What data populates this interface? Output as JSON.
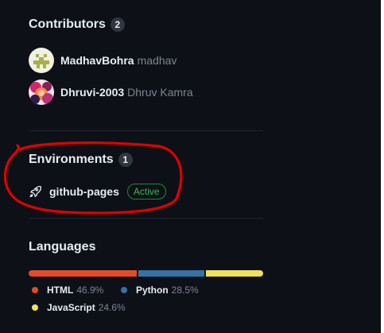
{
  "contributors": {
    "title": "Contributors",
    "count": "2",
    "items": [
      {
        "login": "MadhavBohra",
        "name": "madhav"
      },
      {
        "login": "Dhruvi-2003",
        "name": "Dhruv Kamra"
      }
    ]
  },
  "environments": {
    "title": "Environments",
    "count": "1",
    "items": [
      {
        "name": "github-pages",
        "status": "Active",
        "icon": "rocket-icon"
      }
    ]
  },
  "languages": {
    "title": "Languages",
    "items": [
      {
        "name": "HTML",
        "percent": "46.9%",
        "color": "#e34c26"
      },
      {
        "name": "Python",
        "percent": "28.5%",
        "color": "#3572a5"
      },
      {
        "name": "JavaScript",
        "percent": "24.6%",
        "color": "#f1e05a"
      }
    ]
  },
  "colors": {
    "background": "#0d1117",
    "annotation": "#e00000",
    "active_badge": "#3fb950"
  }
}
